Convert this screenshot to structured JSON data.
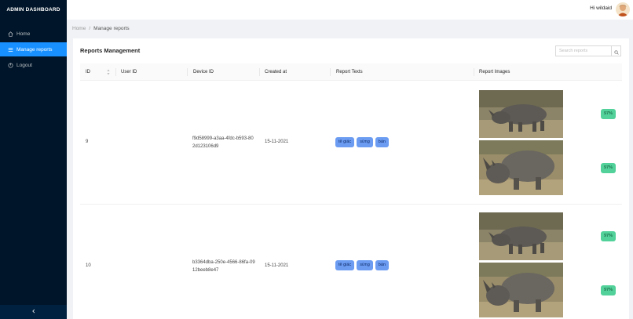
{
  "sidebar": {
    "title": "ADMIN DASHBOARD",
    "items": [
      {
        "label": "Home",
        "icon": "home-icon"
      },
      {
        "label": "Manage reports",
        "icon": "list-icon"
      },
      {
        "label": "Logout",
        "icon": "logout-icon"
      }
    ],
    "collapse_icon": "chevron-left-icon"
  },
  "header": {
    "greeting": "Hi wildaid"
  },
  "breadcrumb": {
    "home": "Home",
    "separator": "/",
    "current": "Manage reports"
  },
  "card": {
    "title": "Reports Management",
    "search_placeholder": "Search reports"
  },
  "table": {
    "columns": [
      "ID",
      "User ID",
      "Device ID",
      "Created at",
      "Report Texts",
      "Report Images"
    ],
    "rows": [
      {
        "id": "9",
        "user_id": "",
        "device_id": "f9d58999-a3aa-4fdc-b593-802d123106d9",
        "created_at": "15-11-2021",
        "texts": [
          "tê giác",
          "sừng",
          "bán"
        ],
        "images": [
          {
            "score": "97%"
          },
          {
            "score": "97%"
          }
        ]
      },
      {
        "id": "10",
        "user_id": "",
        "device_id": "b3364dba-250e-4566-86fa-0912beeb8e47",
        "created_at": "15-11-2021",
        "texts": [
          "tê giác",
          "sừng",
          "bán"
        ],
        "images": [
          {
            "score": "97%"
          },
          {
            "score": "97%"
          }
        ]
      }
    ]
  },
  "colors": {
    "sidebar_bg": "#001529",
    "accent": "#1890ff",
    "tag_bg": "#6b9cf2",
    "score_bg": "#52d19a"
  }
}
